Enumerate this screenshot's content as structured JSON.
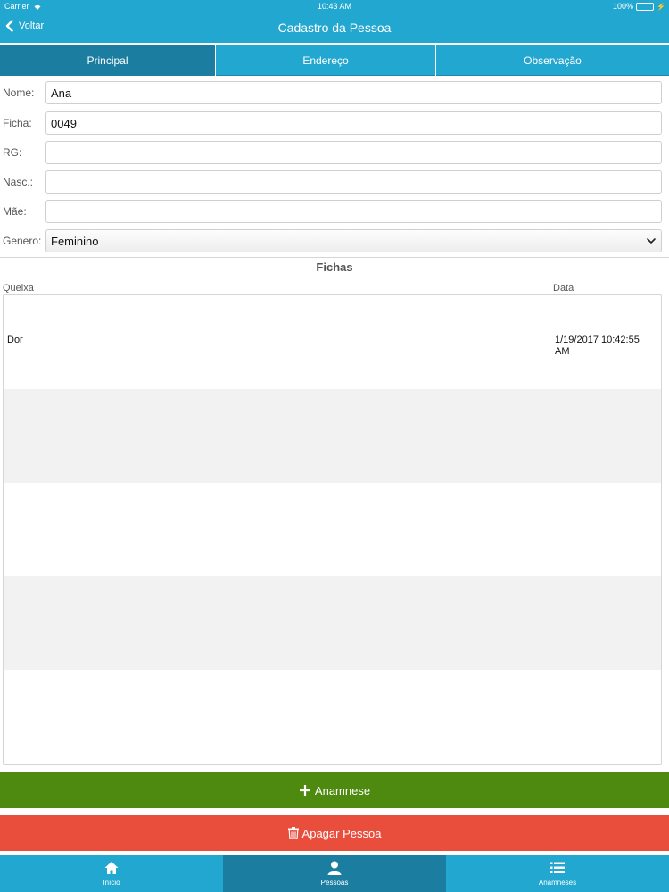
{
  "status_bar": {
    "carrier": "Carrier",
    "time": "10:43 AM",
    "battery": "100%"
  },
  "nav": {
    "back_label": "Voltar",
    "title": "Cadastro da Pessoa"
  },
  "tabs": [
    {
      "label": "Principal",
      "active": true
    },
    {
      "label": "Endereço",
      "active": false
    },
    {
      "label": "Observação",
      "active": false
    }
  ],
  "form": {
    "nome": {
      "label": "Nome:",
      "value": "Ana"
    },
    "ficha": {
      "label": "Ficha:",
      "value": "0049"
    },
    "rg": {
      "label": "RG:",
      "value": ""
    },
    "nasc": {
      "label": "Nasc.:",
      "value": ""
    },
    "mae": {
      "label": "Mãe:",
      "value": ""
    },
    "genero": {
      "label": "Genero:",
      "value": "Feminino"
    }
  },
  "fichas": {
    "title": "Fichas",
    "columns": {
      "queixa": "Queixa",
      "data": "Data"
    },
    "rows": [
      {
        "queixa": "Dor",
        "data": "1/19/2017 10:42:55 AM"
      }
    ]
  },
  "buttons": {
    "add_anamnese": "Anamnese",
    "delete_person": "Apagar Pessoa"
  },
  "tabbar": [
    {
      "label": "Início",
      "icon": "home-icon",
      "active": false
    },
    {
      "label": "Pessoas",
      "icon": "person-icon",
      "active": true
    },
    {
      "label": "Anamneses",
      "icon": "list-icon",
      "active": false
    }
  ],
  "colors": {
    "primary": "#22a7d0",
    "primary_dark": "#1b7ea1",
    "green": "#4f8a10",
    "red": "#e94d3c"
  }
}
